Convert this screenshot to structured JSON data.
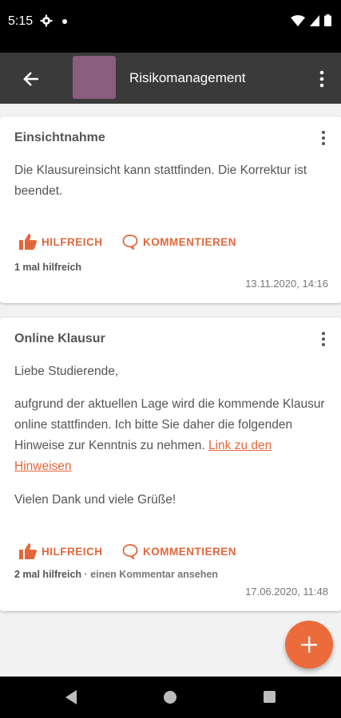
{
  "status_bar": {
    "time": "5:15",
    "icons": [
      "settings-gear-icon",
      "notification-dot-icon",
      "wifi-icon",
      "signal-icon",
      "battery-icon"
    ]
  },
  "app_bar": {
    "title": "Risikomanagement",
    "back_icon": "arrow-back-icon",
    "menu_icon": "more-vert-icon",
    "avatar_color": "#8a5e7e"
  },
  "posts": [
    {
      "title": "Einsichtnahme",
      "body": [
        "Die Klausureinsicht kann stattfinden. Die Korrektur ist beendet."
      ],
      "helpful_label": "HILFREICH",
      "comment_label": "KOMMENTIEREN",
      "helpful_count": "1 mal hilfreich",
      "date": "13.11.2020, 14:16"
    },
    {
      "title": "Online Klausur",
      "greeting": "Liebe Studierende,",
      "body_text": "aufgrund der aktuellen Lage wird die kommende Klausur online stattfinden. Ich bitte Sie daher die folgenden Hinweise zur Kenntnis zu nehmen. ",
      "link_text": "Link zu den Hinweisen",
      "closing": "Vielen Dank und viele Grüße!",
      "helpful_label": "HILFREICH",
      "comment_label": "KOMMENTIEREN",
      "helpful_count": "2 mal hilfreich",
      "comment_link": " · einen Kommentar ansehen",
      "date": "17.06.2020, 11:48"
    }
  ],
  "fab": {
    "icon": "plus-icon",
    "color": "#ec6b3b"
  },
  "accent_color": "#e2663b",
  "nav_bar": {
    "icons": [
      "nav-back-icon",
      "nav-home-icon",
      "nav-recents-icon"
    ]
  }
}
